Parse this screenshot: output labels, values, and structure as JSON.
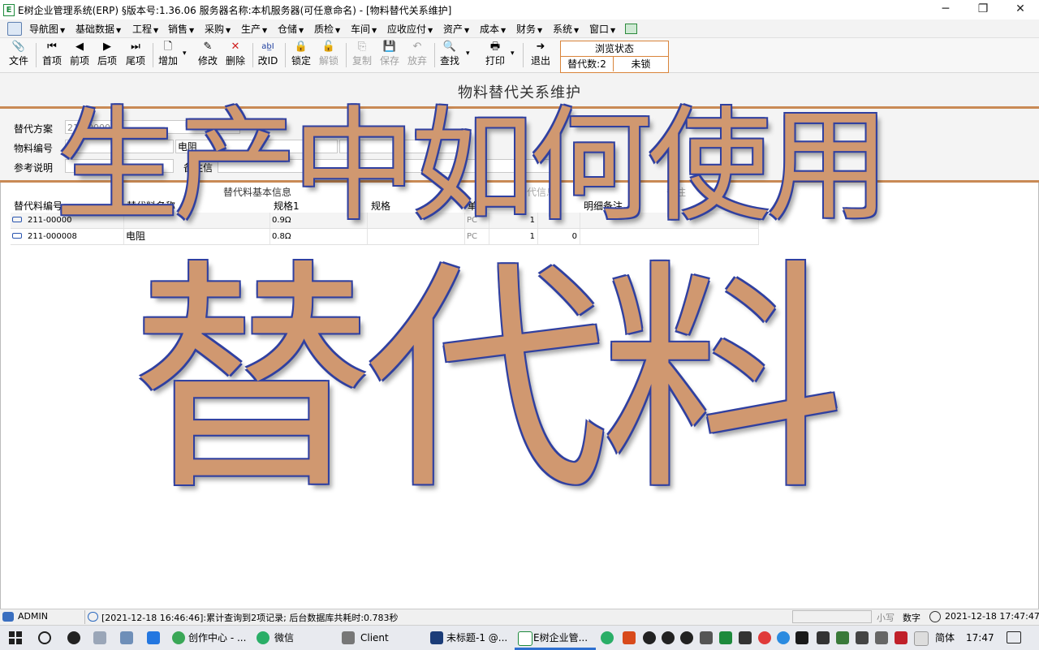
{
  "window": {
    "title": "E树企业管理系统(ERP) §版本号:1.36.06  服务器名称:本机服务器(可任意命名) - [物料替代关系维护]",
    "app_icon": "E",
    "controls": [
      "─",
      "❐",
      "✕"
    ]
  },
  "menu": {
    "items": [
      "导航图",
      "基础数据",
      "工程",
      "销售",
      "采购",
      "生产",
      "仓储",
      "质检",
      "车间",
      "应收应付",
      "资产",
      "成本",
      "财务",
      "系统",
      "窗口"
    ]
  },
  "toolbar": {
    "file": "文件",
    "first": "首项",
    "prev": "前项",
    "next": "后项",
    "last": "尾项",
    "add": "增加",
    "edit": "修改",
    "delete": "删除",
    "change_id": "改ID",
    "lock": "锁定",
    "unlock": "解锁",
    "copy": "复制",
    "save": "保存",
    "discard": "放弃",
    "find": "查找",
    "print": "打印",
    "exit": "退出",
    "first_icon": "⏮",
    "prev_icon": "◀",
    "next_icon": "▶",
    "last_icon": "⏭",
    "add_icon": "🗋",
    "edit_icon": "✎",
    "delete_icon": "✕",
    "change_id_icon": "ab̲I",
    "lock_icon": "🔒",
    "unlock_icon": "🔓",
    "copy_icon": "⎘",
    "save_icon": "💾",
    "discard_icon": "↶",
    "find_icon": "🔍",
    "print_icon": "🖶",
    "exit_icon": "➜",
    "file_icon": "📎",
    "dropdown": "▾"
  },
  "status_box": {
    "header": "浏览状态",
    "count_label": "替代数:2",
    "lock_state": "未锁"
  },
  "form": {
    "title": "物料替代关系维护",
    "plan_label": "替代方案",
    "plan_value": "211-000002",
    "material_label": "物料编号",
    "material_name": "电阻",
    "ref_label": "参考说明",
    "note_label": "备注信"
  },
  "grid": {
    "group_header": "替代料基本信息",
    "group_header2": "替代信息",
    "group_header3": "备注",
    "columns": [
      "替代料编号",
      "替代料名称",
      "规格1",
      "规格",
      "单位",
      "",
      "明细备注"
    ],
    "rows": [
      {
        "code": "211-00000",
        "name": "",
        "spec1": "0.9Ω",
        "unit": "PC",
        "qty": "1",
        "n2": ""
      },
      {
        "code": "211-000008",
        "name": "电阻",
        "spec1": "0.8Ω",
        "unit": "PC",
        "qty": "1",
        "n2": "0"
      }
    ]
  },
  "overlay": {
    "line1": "生产中如何使用",
    "line2": "替代料"
  },
  "statusbar": {
    "user": "ADMIN",
    "message": "[2021-12-18 16:46:46]:累计查询到2项记录; 后台数据库共耗时:0.783秒",
    "caps": "小写",
    "num": "数字",
    "datetime": "2021-12-18 17:47:47"
  },
  "taskbar": {
    "apps": [
      {
        "label": "创作中心 - ...",
        "icon_color": "#3aa757"
      },
      {
        "label": "微信",
        "icon_color": "#2aae67"
      },
      {
        "label": "Client",
        "icon_color": "#777777"
      },
      {
        "label": "未标题-1 @...",
        "icon_color": "#1b3c78"
      },
      {
        "label": "E树企业管...",
        "icon_color": "#1d8a3c"
      }
    ],
    "ime": "简体",
    "time": "17:47"
  }
}
